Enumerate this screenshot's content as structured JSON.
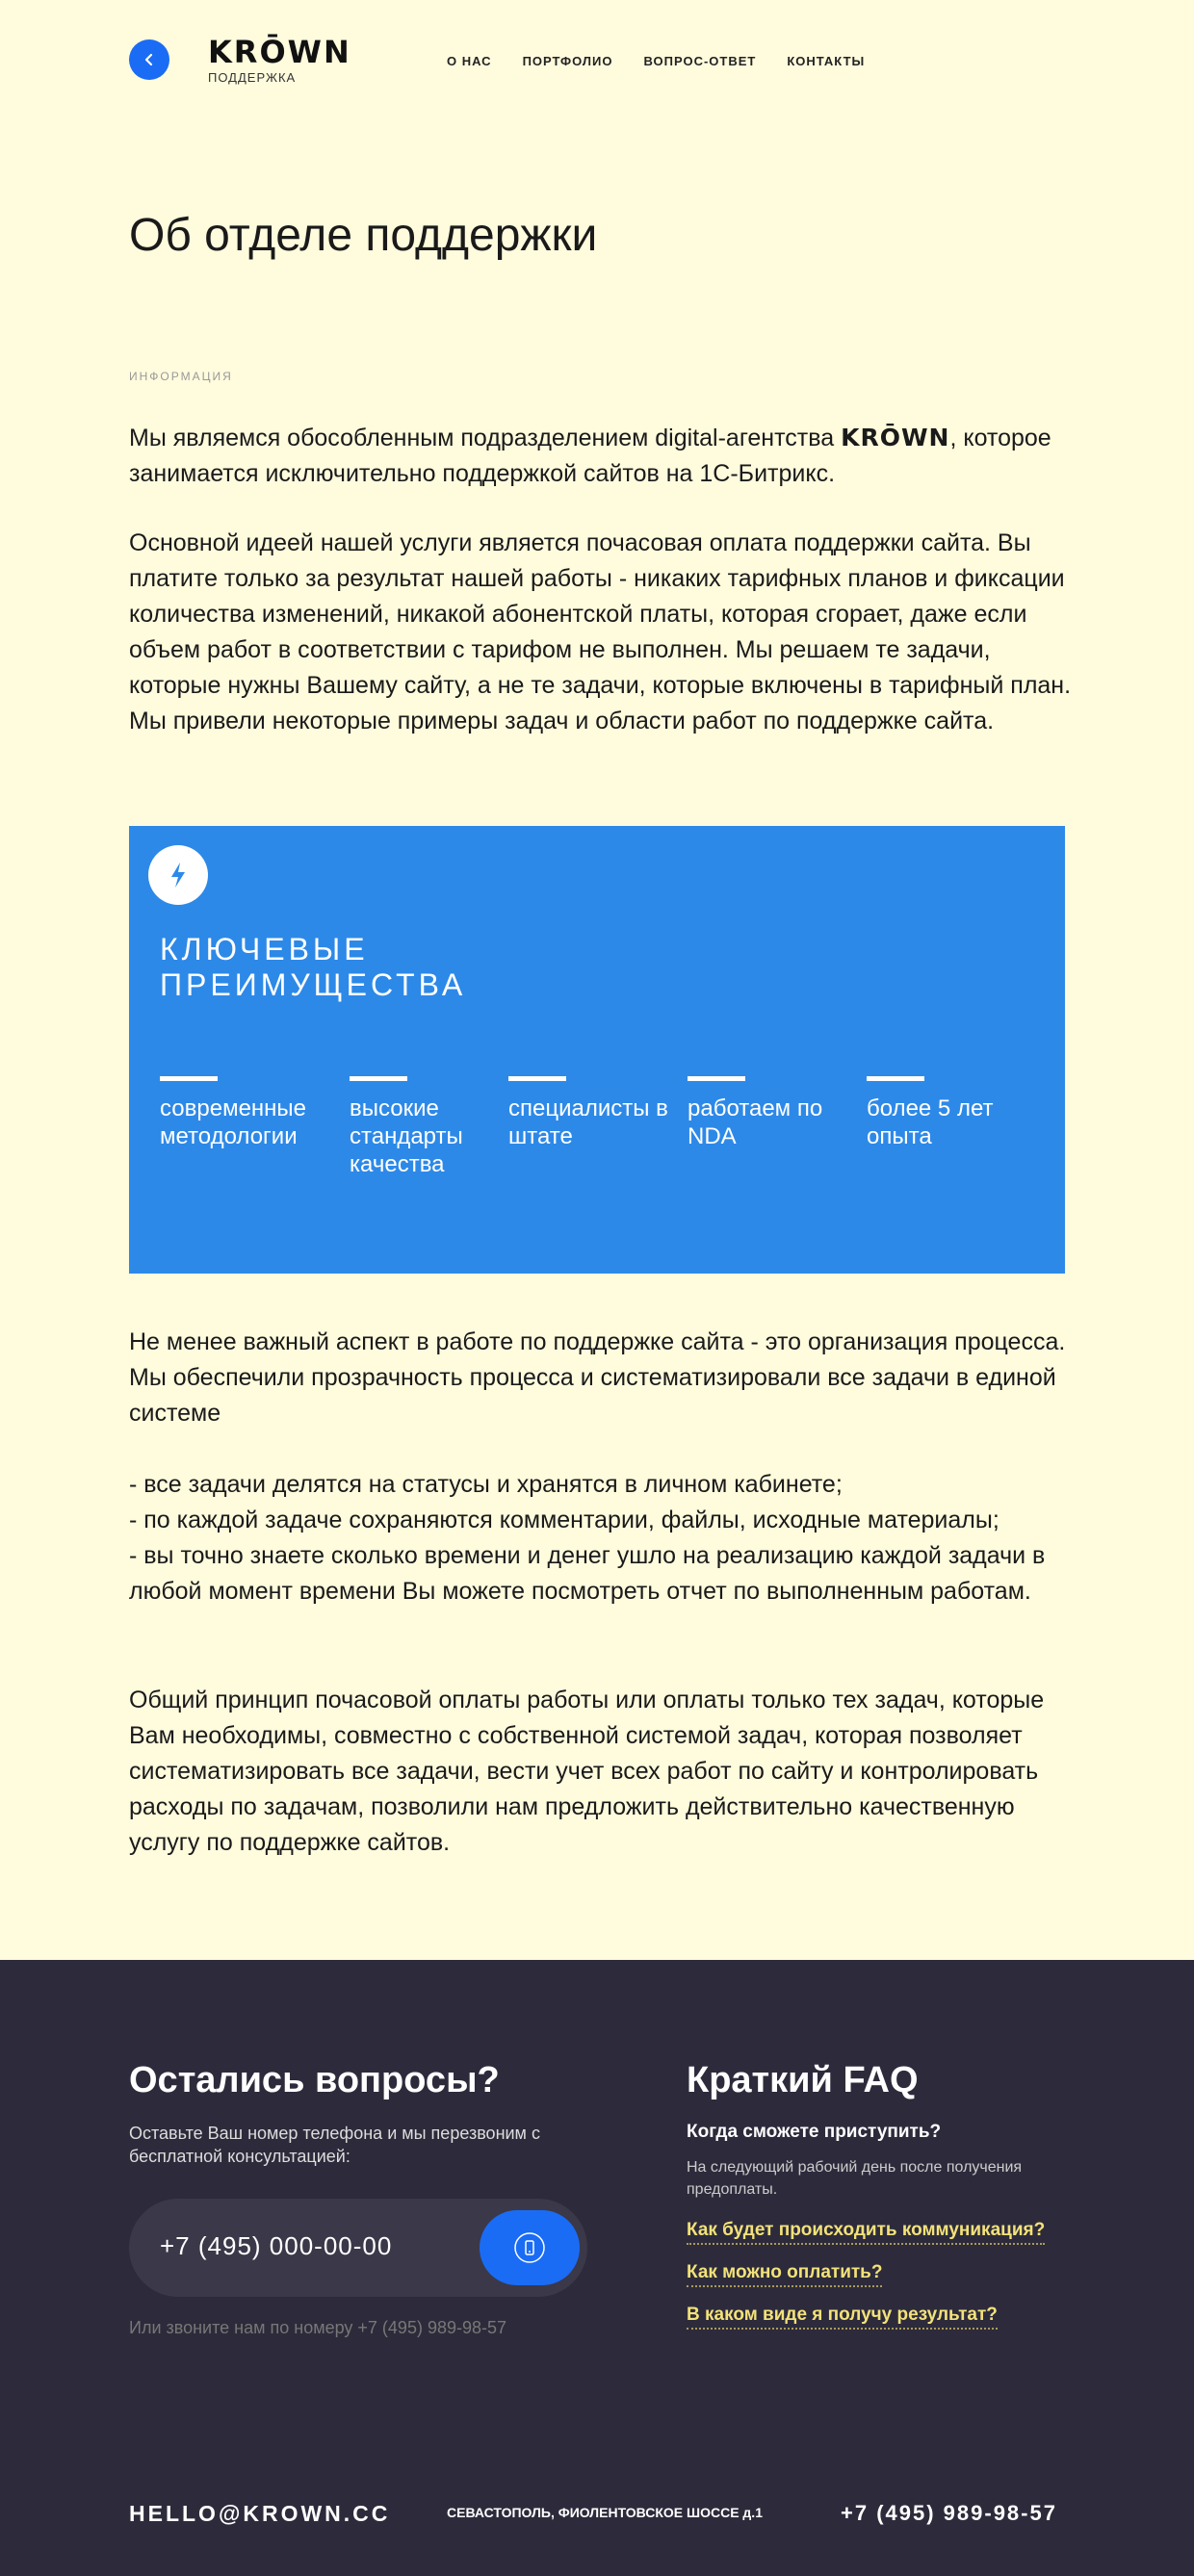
{
  "header": {
    "logo": "KRŌWN",
    "logo_sub": "ПОДДЕРЖКА",
    "nav": [
      "О НАС",
      "ПОРТФОЛИО",
      "ВОПРОС-ОТВЕТ",
      "КОНТАКТЫ"
    ]
  },
  "main": {
    "title": "Об отделе поддержки",
    "section_label": "ИНФОРМАЦИЯ",
    "para1_before": "Мы являемся обособленным подразделением digital-агентства ",
    "para1_brand": "KRŌWN",
    "para1_after": ", которое занимается исключительно поддержкой сайтов на 1С-Битрикс.",
    "para2": "Основной идеей нашей услуги является почасовая оплата поддержки сайта. Вы платите только за результат нашей работы - никаких тарифных планов и фиксации количества изменений, никакой абонентской платы, которая сгорает, даже если объем работ в соответствии с тарифом не выполнен. Мы решаем те задачи, которые нужны Вашему сайту, а не те задачи, которые включены в тарифный план. Мы привели некоторые примеры задач и области работ по поддержке сайта.",
    "para3": "Не менее важный аспект в работе по поддержке сайта - это организация процесса. Мы обеспечили прозрачность процесса и систематизировали все задачи в единой системе",
    "para4_lines": [
      "- все задачи делятся на статусы и хранятся в личном кабинете;",
      "- по каждой задаче сохраняются комментарии, файлы, исходные материалы;",
      "- вы точно знаете сколько времени и денег ушло на реализацию каждой задачи в любой момент времени Вы можете посмотреть отчет по выполненным работам."
    ],
    "para5": "Общий принцип почасовой оплаты работы или оплаты только тех задач, которые Вам необходимы, совместно с собственной системой задач, которая позволяет систематизировать все задачи, вести учет всех работ по сайту и контролировать расходы по задачам, позволили нам предложить действительно качественную услугу по поддержке сайтов."
  },
  "advantages": {
    "icon": "lightning-icon",
    "title": "КЛЮЧЕВЫЕ ПРЕИМУЩЕСТВА",
    "items": [
      "современные методологии",
      "высокие стандарты качества",
      "специалисты в штате",
      "работаем по NDA",
      "более 5 лет опыта"
    ]
  },
  "contact": {
    "title": "Остались вопросы?",
    "desc": "Оставьте Ваш номер телефона и мы перезвоним с бесплатной консультацией:",
    "phone_value": "+7 (495) 000-00-00",
    "call_hint": "Или звоните нам по номеру +7 (495) 989-98-57"
  },
  "faq": {
    "title": "Краткий FAQ",
    "q1": "Когда сможете приступить?",
    "a1": "На следующий рабочий день после получения предоплаты.",
    "links": [
      "Как будет происходить коммуникация?",
      "Как можно оплатить?",
      "В каком виде я получу результат?"
    ]
  },
  "footer": {
    "email": "HELLO@KROWN.CC",
    "address": "СЕВАСТОПОЛЬ, ФИОЛЕНТОВСКОЕ ШОССЕ  д.1",
    "phone": "+7 (495) 989-98-57"
  },
  "colors": {
    "background": "#fffbdd",
    "accent_blue": "#1a6cf5",
    "advantages_blue": "#2d89e8",
    "dark": "#2d2b3b",
    "faq_link": "#f3e27a"
  }
}
